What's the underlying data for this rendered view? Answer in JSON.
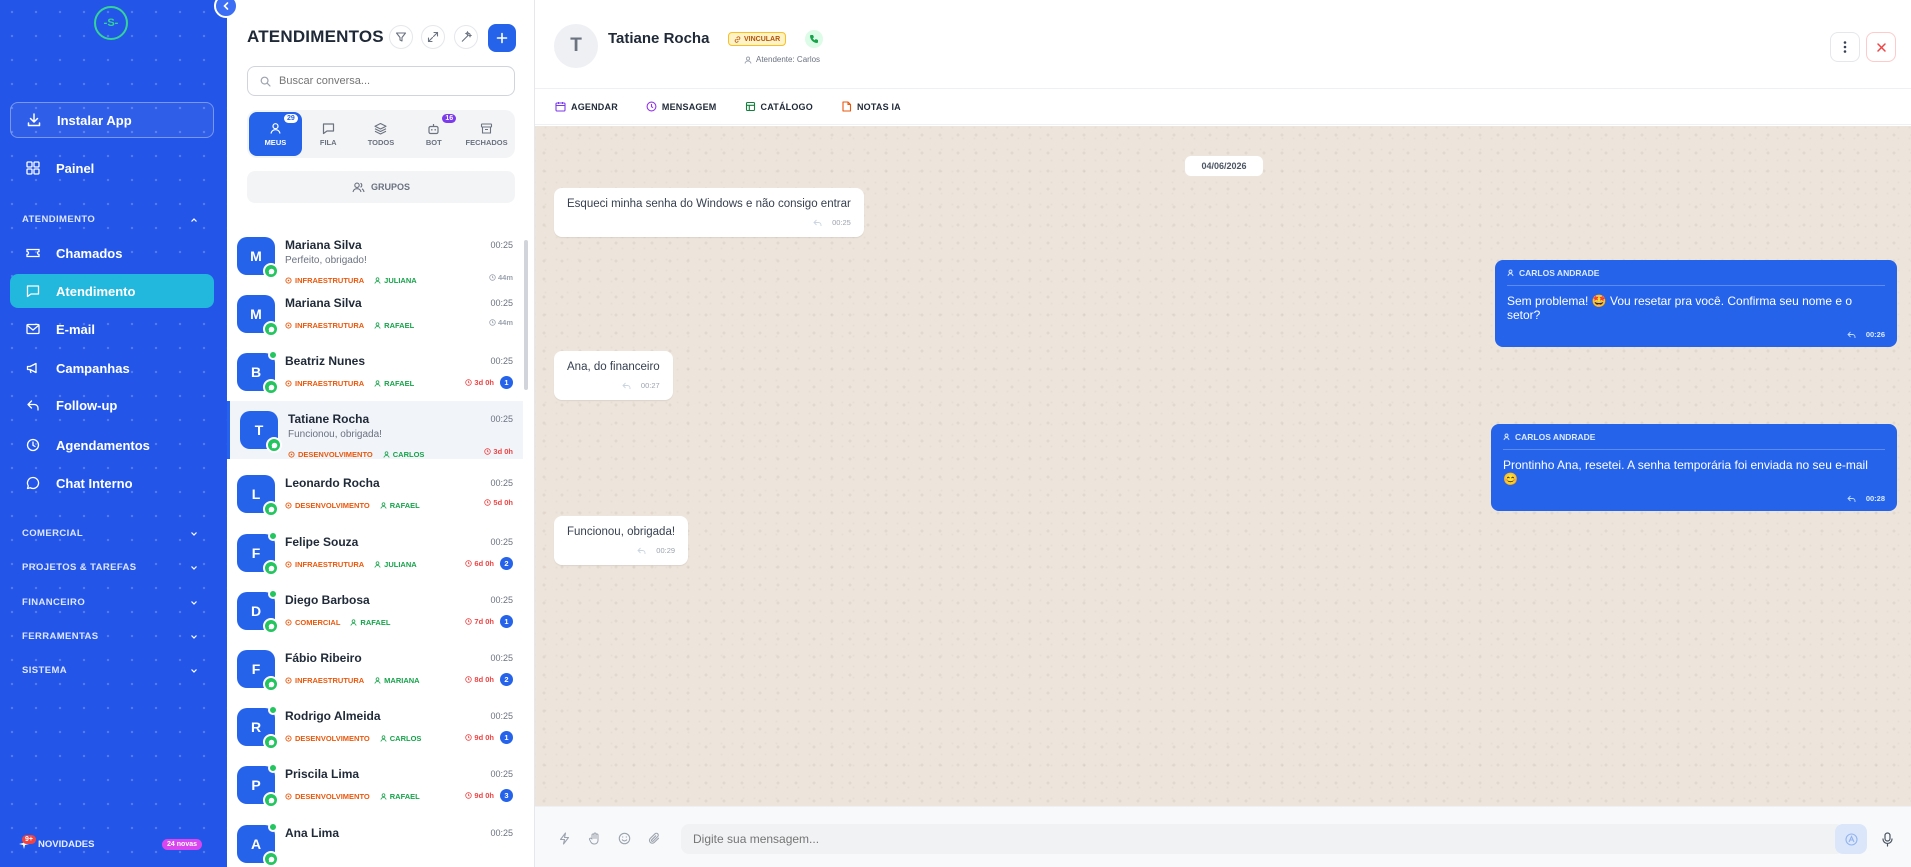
{
  "app": {
    "name": "Atendimentos"
  },
  "sidebar": {
    "logo_text": "-S-",
    "install_label": "Instalar App",
    "painel_label": "Painel",
    "section_atendimento": "ATENDIMENTO",
    "items": [
      {
        "label": "Chamados",
        "icon": "ticket-icon"
      },
      {
        "label": "Atendimento",
        "icon": "chat-bubble-icon",
        "active": true
      },
      {
        "label": "E-mail",
        "icon": "mail-icon"
      },
      {
        "label": "Campanhas",
        "icon": "megaphone-icon"
      },
      {
        "label": "Follow-up",
        "icon": "reply-arrow-icon"
      },
      {
        "label": "Agendamentos",
        "icon": "clock-icon"
      },
      {
        "label": "Chat Interno",
        "icon": "chat-circle-icon"
      }
    ],
    "sections": [
      {
        "label": "COMERCIAL"
      },
      {
        "label": "PROJETOS & TAREFAS"
      },
      {
        "label": "FINANCEIRO"
      },
      {
        "label": "FERRAMENTAS"
      },
      {
        "label": "SISTEMA"
      }
    ],
    "news_label": "NOVIDADES",
    "news_badge": "9+",
    "news_pill": "24 novas"
  },
  "conversations": {
    "title": "ATENDIMENTOS",
    "search_placeholder": "Buscar conversa...",
    "tabs": [
      {
        "label": "MEUS",
        "count": "29",
        "active": true
      },
      {
        "label": "FILA",
        "count": ""
      },
      {
        "label": "TODOS",
        "count": ""
      },
      {
        "label": "BOT",
        "count": "16"
      },
      {
        "label": "FECHADOS",
        "count": ""
      }
    ],
    "groups_label": "GRUPOS",
    "rows": [
      {
        "initial": "M",
        "name": "Mariana Silva",
        "time": "00:25",
        "preview": "Perfeito, obrigado!",
        "dept": "INFRAESTRUTURA",
        "agent": "JULIANA",
        "elapsed": "44m",
        "unread": "",
        "online": false
      },
      {
        "initial": "M",
        "name": "Mariana Silva",
        "time": "00:25",
        "preview": "",
        "dept": "INFRAESTRUTURA",
        "agent": "RAFAEL",
        "elapsed": "44m",
        "unread": "",
        "online": false
      },
      {
        "initial": "B",
        "name": "Beatriz Nunes",
        "time": "00:25",
        "preview": "",
        "dept": "INFRAESTRUTURA",
        "agent": "RAFAEL",
        "elapsed": "3d 0h",
        "unread": "1",
        "online": true
      },
      {
        "initial": "T",
        "name": "Tatiane Rocha",
        "time": "00:25",
        "preview": "Funcionou, obrigada!",
        "dept": "DESENVOLVIMENTO",
        "agent": "CARLOS",
        "elapsed": "3d 0h",
        "unread": "",
        "online": false
      },
      {
        "initial": "L",
        "name": "Leonardo Rocha",
        "time": "00:25",
        "preview": "",
        "dept": "DESENVOLVIMENTO",
        "agent": "RAFAEL",
        "elapsed": "5d 0h",
        "unread": "",
        "online": false
      },
      {
        "initial": "F",
        "name": "Felipe Souza",
        "time": "00:25",
        "preview": "",
        "dept": "INFRAESTRUTURA",
        "agent": "JULIANA",
        "elapsed": "6d 0h",
        "unread": "2",
        "online": true
      },
      {
        "initial": "D",
        "name": "Diego Barbosa",
        "time": "00:25",
        "preview": "",
        "dept": "COMERCIAL",
        "agent": "RAFAEL",
        "elapsed": "7d 0h",
        "unread": "1",
        "online": true
      },
      {
        "initial": "F",
        "name": "Fábio Ribeiro",
        "time": "00:25",
        "preview": "",
        "dept": "INFRAESTRUTURA",
        "agent": "MARIANA",
        "elapsed": "8d 0h",
        "unread": "2",
        "online": false
      },
      {
        "initial": "R",
        "name": "Rodrigo Almeida",
        "time": "00:25",
        "preview": "",
        "dept": "DESENVOLVIMENTO",
        "agent": "CARLOS",
        "elapsed": "9d 0h",
        "unread": "1",
        "online": true
      },
      {
        "initial": "P",
        "name": "Priscila Lima",
        "time": "00:25",
        "preview": "",
        "dept": "DESENVOLVIMENTO",
        "agent": "RAFAEL",
        "elapsed": "9d 0h",
        "unread": "3",
        "online": true
      },
      {
        "initial": "A",
        "name": "Ana Lima",
        "time": "00:25",
        "preview": "",
        "dept": "",
        "agent": "",
        "elapsed": "",
        "unread": "",
        "online": true
      }
    ]
  },
  "chat": {
    "contact_initial": "T",
    "contact_name": "Tatiane Rocha",
    "vincular_label": "VINCULAR",
    "attendant_label": "Atendente: Carlos",
    "toolbar": [
      {
        "label": "AGENDAR",
        "color": "#7c3aed",
        "icon": "calendar-icon"
      },
      {
        "label": "MENSAGEM",
        "color": "#9333ea",
        "icon": "clock-icon"
      },
      {
        "label": "CATÁLOGO",
        "color": "#15803d",
        "icon": "catalog-icon"
      },
      {
        "label": "NOTAS IA",
        "color": "#ea580c",
        "icon": "notes-icon"
      }
    ],
    "date_chip": "04/06/2026",
    "messages": [
      {
        "direction": "in",
        "text": "Esqueci minha senha do Windows e não consigo entrar",
        "time": "00:25"
      },
      {
        "direction": "out",
        "sender": "CARLOS ANDRADE",
        "text": "Sem problema! 🤩 Vou resetar pra você. Confirma seu nome e o setor?",
        "time": "00:26"
      },
      {
        "direction": "in",
        "text": "Ana, do financeiro",
        "time": "00:27"
      },
      {
        "direction": "out",
        "sender": "CARLOS ANDRADE",
        "text": "Prontinho Ana, resetei. A senha temporária foi enviada no seu e-mail 😊",
        "time": "00:28"
      },
      {
        "direction": "in",
        "text": "Funcionou, obrigada!",
        "time": "00:29"
      }
    ],
    "composer_placeholder": "Digite sua mensagem..."
  },
  "colors": {
    "sidebar": "#2356e8",
    "active_nav": "#22b7dc",
    "primary": "#2563eb",
    "dept_tag": "#ea580c",
    "agent_tag": "#16a34a",
    "alert": "#ef4444",
    "chat_background": "#ede5dc"
  }
}
